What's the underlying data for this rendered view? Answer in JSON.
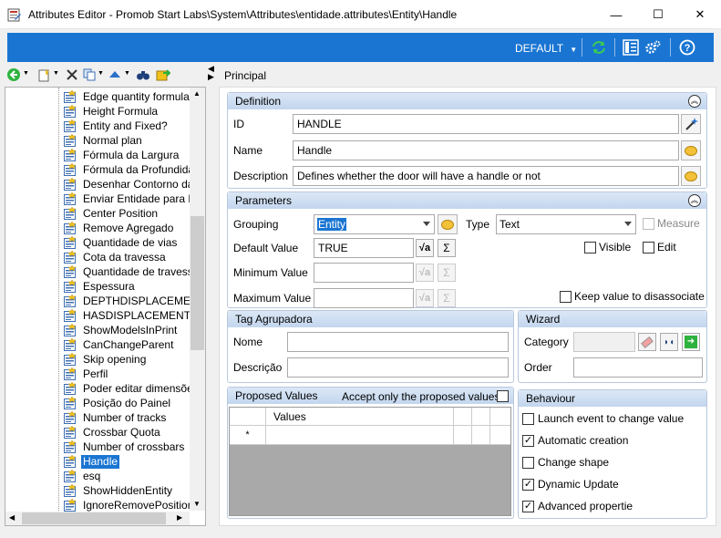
{
  "window": {
    "title": "Attributes Editor - Promob Start Labs\\System\\Attributes\\entidade.attributes\\Entity\\Handle",
    "minimize": "—",
    "maximize": "☐",
    "close": "✕"
  },
  "toolbar": {
    "profile": "DEFAULT",
    "refresh_icon": "refresh-icon",
    "list_icon": "list-icon",
    "settings_icon": "settings-icon",
    "help_icon": "help-icon",
    "accent": "#1a75d2"
  },
  "tree": {
    "items": [
      "Edge quantity formula",
      "Height Formula",
      "Entity and Fixed?",
      "Normal plan",
      "Fórmula da Largura",
      "Fórmula da Profundidade",
      "Desenhar Contorno da M",
      "Enviar Entidade para Dy",
      "Center Position",
      "Remove Agregado",
      "Quantidade de vias",
      "Cota da travessa",
      "Quantidade de travessa",
      "Espessura",
      "DEPTHDISPLACEMENT",
      "HASDISPLACEMENT",
      "ShowModelsInPrint",
      "CanChangeParent",
      "Skip opening",
      "Perfil",
      "Poder editar dimensões",
      "Posição do Painel",
      "Number of tracks",
      "Crossbar Quota",
      "Number of crossbars",
      "Handle",
      "esq",
      "ShowHiddenEntity",
      "IgnoreRemovePosition"
    ],
    "selected": "Handle"
  },
  "main": {
    "tab": "Principal",
    "definition": {
      "title": "Definition",
      "id_label": "ID",
      "id_value": "HANDLE",
      "name_label": "Name",
      "name_value": "Handle",
      "description_label": "Description",
      "description_value": "Defines whether the door will have a handle or not"
    },
    "parameters": {
      "title": "Parameters",
      "grouping_label": "Grouping",
      "grouping_value": "Entity",
      "type_label": "Type",
      "type_value": "Text",
      "measure_label": "Measure",
      "default_label": "Default Value",
      "default_value": "TRUE",
      "minimum_label": "Minimum Value",
      "maximum_label": "Maximum Value",
      "visible_label": "Visible",
      "edit_label": "Edit",
      "keep_label": "Keep value to disassociate",
      "sigma": "Σ"
    },
    "tag": {
      "title": "Tag Agrupadora",
      "nome_label": "Nome",
      "descricao_label": "Descrição"
    },
    "wizard": {
      "title": "Wizard",
      "category_label": "Category",
      "order_label": "Order"
    },
    "proposed": {
      "title": "Proposed Values",
      "accept_label": "Accept only the proposed values",
      "column_values": "Values",
      "new_row_marker": "*"
    },
    "behaviour": {
      "title": "Behaviour",
      "items": [
        {
          "label": "Launch event to change value",
          "checked": false
        },
        {
          "label": "Automatic creation",
          "checked": true
        },
        {
          "label": "Change shape",
          "checked": false
        },
        {
          "label": "Dynamic Update",
          "checked": true
        },
        {
          "label": "Advanced propertie",
          "checked": true
        }
      ]
    }
  }
}
